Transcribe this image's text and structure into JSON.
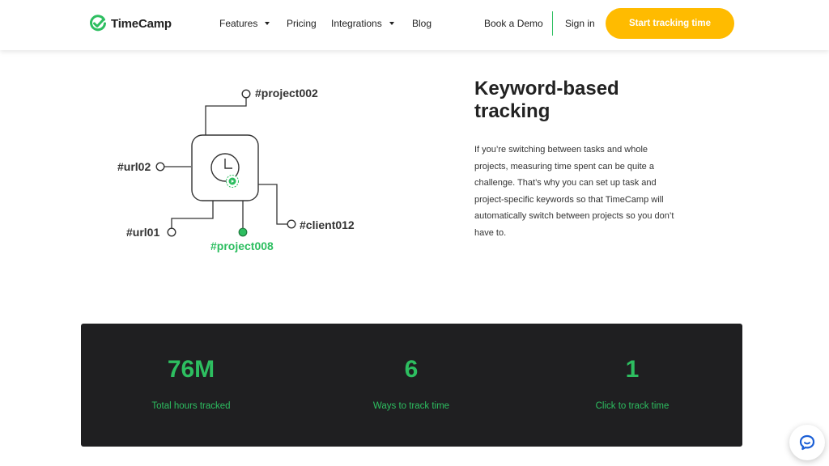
{
  "brand": {
    "name": "TimeCamp",
    "color": "#2dbe60"
  },
  "nav": {
    "features": "Features",
    "pricing": "Pricing",
    "integrations": "Integrations",
    "blog": "Blog",
    "book_demo": "Book a Demo",
    "sign_in": "Sign in",
    "cta": "Start tracking time",
    "cta_color": "#ffbb00"
  },
  "diagram": {
    "tags": {
      "project002": "#project002",
      "url02": "#url02",
      "client012": "#client012",
      "url01": "#url01",
      "project008": "#project008"
    },
    "active_tag": "#project008"
  },
  "feature": {
    "title_line1": "Keyword-based",
    "title_line2": "tracking",
    "description": "If you’re switching between tasks and whole projects, measuring time spent can be quite a challenge. That’s why you can set up task and project-specific keywords so that TimeCamp will automatically switch between projects so you don’t have to."
  },
  "stats": [
    {
      "value": "76M",
      "label": "Total hours tracked"
    },
    {
      "value": "6",
      "label": "Ways to track time"
    },
    {
      "value": "1",
      "label": "Click to track time"
    }
  ],
  "chat": {
    "icon": "chat-bubble-icon"
  }
}
